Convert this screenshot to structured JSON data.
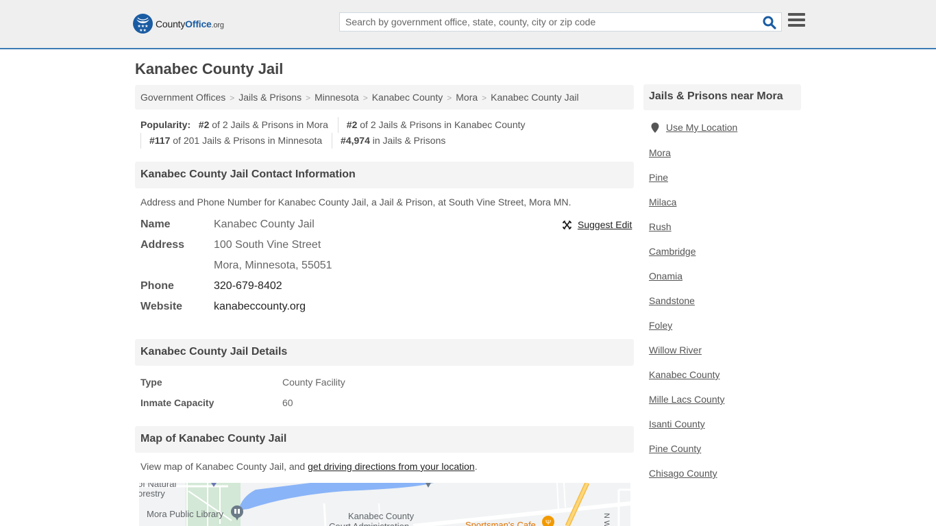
{
  "header": {
    "logo": {
      "name_part1": "County",
      "name_part2": "Office",
      "name_part3": ".org"
    },
    "search": {
      "placeholder": "Search by government office, state, county, city or zip code",
      "value": ""
    },
    "colors": {
      "brand": "#1a5ca3",
      "accent_border": "#3a7bb5"
    }
  },
  "page": {
    "title": "Kanabec County Jail"
  },
  "breadcrumb": [
    {
      "label": "Government Offices"
    },
    {
      "label": "Jails & Prisons"
    },
    {
      "label": "Minnesota"
    },
    {
      "label": "Kanabec County"
    },
    {
      "label": "Mora"
    },
    {
      "label": "Kanabec County Jail"
    }
  ],
  "popularity": {
    "label": "Popularity:",
    "items": [
      {
        "rank": "#2",
        "text": " of 2 Jails & Prisons in Mora"
      },
      {
        "rank": "#2",
        "text": " of 2 Jails & Prisons in Kanabec County"
      },
      {
        "rank": "#117",
        "text": " of 201 Jails & Prisons in Minnesota"
      },
      {
        "rank": "#4,974",
        "text": " in Jails & Prisons"
      }
    ]
  },
  "contact": {
    "heading": "Kanabec County Jail Contact Information",
    "description": "Address and Phone Number for Kanabec County Jail, a Jail & Prison, at South Vine Street, Mora MN.",
    "suggest_edit": "Suggest Edit",
    "name_label": "Name",
    "name_value": "Kanabec County Jail",
    "address_label": "Address",
    "address_line1": "100 South Vine Street",
    "address_line2": "Mora, Minnesota, 55051",
    "phone_label": "Phone",
    "phone_value": "320-679-8402",
    "website_label": "Website",
    "website_value": "kanabeccounty.org"
  },
  "details": {
    "heading": "Kanabec County Jail Details",
    "rows": [
      {
        "label": "Type",
        "value": "County Facility"
      },
      {
        "label": "Inmate Capacity",
        "value": "60"
      }
    ]
  },
  "map": {
    "heading": "Map of Kanabec County Jail",
    "desc_prefix": "View map of Kanabec County Jail, and ",
    "directions_link": "get driving directions from your location",
    "desc_suffix": ".",
    "labels": {
      "forestry_1": "of Natural",
      "forestry_2": "orestry",
      "library": "Mora Public Library",
      "court_1": "Kanabec County",
      "court_2": "Court Administration",
      "cafe": "Sportsman's Cafe",
      "street": "N Wa"
    }
  },
  "sidebar": {
    "heading": "Jails & Prisons near Mora",
    "use_location": "Use My Location",
    "links": [
      "Mora",
      "Pine",
      "Milaca",
      "Rush",
      "Cambridge",
      "Onamia",
      "Sandstone",
      "Foley",
      "Willow River",
      "Kanabec County",
      "Mille Lacs County",
      "Isanti County",
      "Pine County",
      "Chisago County"
    ]
  }
}
